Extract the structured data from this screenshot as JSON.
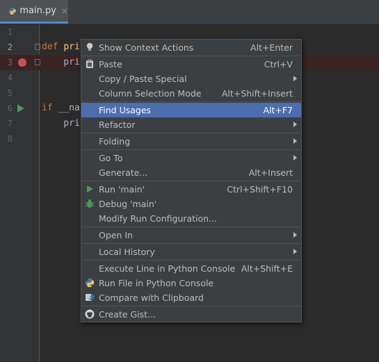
{
  "tab": {
    "label": "main.py",
    "close": "×"
  },
  "lines": [
    {
      "num": "1"
    },
    {
      "num": "2",
      "tokens": [
        {
          "t": "def ",
          "c": "kw"
        },
        {
          "t": "pri",
          "c": "fn"
        }
      ]
    },
    {
      "num": "3",
      "tokens": [
        {
          "t": "    pri",
          "c": "plain"
        }
      ]
    },
    {
      "num": "4"
    },
    {
      "num": "5"
    },
    {
      "num": "6",
      "tokens": [
        {
          "t": "if ",
          "c": "kw"
        },
        {
          "t": "__na",
          "c": "plain"
        }
      ]
    },
    {
      "num": "7",
      "tokens": [
        {
          "t": "    pri",
          "c": "plain"
        }
      ]
    },
    {
      "num": "8"
    }
  ],
  "menu": {
    "items": [
      {
        "label": "Show Context Actions",
        "shortcut": "Alt+Enter",
        "icon": "bulb-icon"
      },
      {
        "label": "Paste",
        "shortcut": "Ctrl+V",
        "icon": "clipboard-icon"
      },
      {
        "label": "Copy / Paste Special",
        "shortcut": "",
        "submenu": true
      },
      {
        "label": "Column Selection Mode",
        "shortcut": "Alt+Shift+Insert"
      },
      {
        "label": "Find Usages",
        "shortcut": "Alt+F7",
        "highlighted": true
      },
      {
        "label": "Refactor",
        "shortcut": "",
        "submenu": true
      },
      {
        "label": "Folding",
        "shortcut": "",
        "submenu": true
      },
      {
        "label": "Go To",
        "shortcut": "",
        "submenu": true
      },
      {
        "label": "Generate...",
        "shortcut": "Alt+Insert"
      },
      {
        "label": "Run 'main'",
        "shortcut": "Ctrl+Shift+F10",
        "icon": "run-icon"
      },
      {
        "label": "Debug 'main'",
        "shortcut": "",
        "icon": "debug-icon"
      },
      {
        "label": "Modify Run Configuration...",
        "shortcut": ""
      },
      {
        "label": "Open In",
        "shortcut": "",
        "submenu": true
      },
      {
        "label": "Local History",
        "shortcut": "",
        "submenu": true
      },
      {
        "label": "Execute Line in Python Console",
        "shortcut": "Alt+Shift+E"
      },
      {
        "label": "Run File in Python Console",
        "shortcut": "",
        "icon": "python-icon"
      },
      {
        "label": "Compare with Clipboard",
        "shortcut": "",
        "icon": "compare-icon"
      },
      {
        "label": "Create Gist...",
        "shortcut": "",
        "icon": "github-icon"
      }
    ]
  },
  "colors": {
    "accent": "#4b6eaf",
    "breakpoint": "#c75450",
    "run": "#499c54"
  }
}
